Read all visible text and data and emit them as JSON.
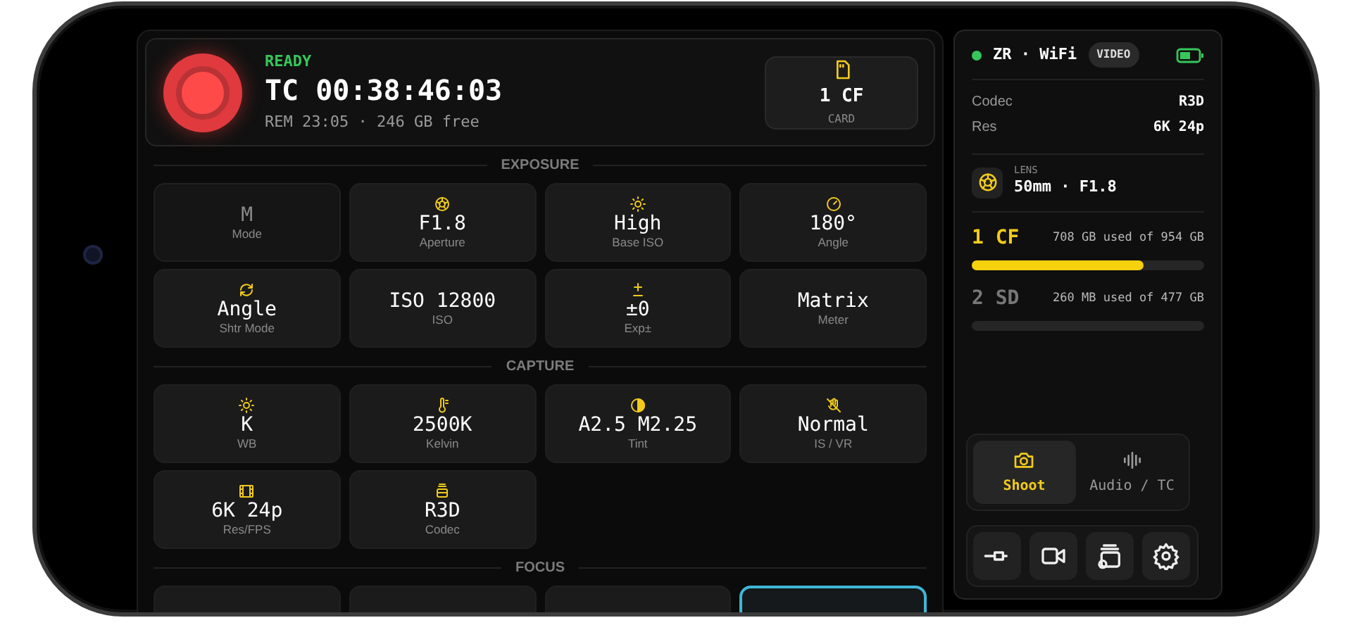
{
  "record": {
    "status": "READY",
    "timecode": "TC 00:38:46:03",
    "remaining": "REM 23:05 · 246 GB free",
    "card_value": "1 CF",
    "card_label": "CARD"
  },
  "sections": [
    {
      "title": "EXPOSURE",
      "tiles": [
        {
          "value": "M",
          "label": "Mode",
          "disabled": true
        },
        {
          "value": "F1.8",
          "label": "Aperture",
          "disabled": false
        },
        {
          "value": "High",
          "label": "Base ISO",
          "disabled": false
        },
        {
          "value": "180°",
          "label": "Angle",
          "disabled": false
        },
        {
          "value": "Angle",
          "label": "Shtr Mode",
          "disabled": false
        },
        {
          "value": "ISO 12800",
          "label": "ISO",
          "disabled": false
        },
        {
          "value": "±0",
          "label": "Exp±",
          "disabled": false
        },
        {
          "value": "Matrix",
          "label": "Meter",
          "disabled": false
        }
      ]
    },
    {
      "title": "CAPTURE",
      "tiles": [
        {
          "value": "K",
          "label": "WB",
          "disabled": false
        },
        {
          "value": "2500K",
          "label": "Kelvin",
          "disabled": false
        },
        {
          "value": "A2.5 M2.25",
          "label": "Tint",
          "disabled": false
        },
        {
          "value": "Normal",
          "label": "IS / VR",
          "disabled": false
        },
        {
          "value": "6K 24p",
          "label": "Res/FPS",
          "disabled": false
        },
        {
          "value": "R3D",
          "label": "Codec",
          "disabled": false
        }
      ]
    },
    {
      "title": "FOCUS",
      "tiles": [
        {
          "selected": false
        },
        {
          "selected": false
        },
        {
          "selected": false
        },
        {
          "selected": true
        }
      ]
    }
  ],
  "side": {
    "connected": true,
    "connection": "ZR · WiFi",
    "mode_badge": "VIDEO",
    "specs": [
      {
        "label": "Codec",
        "value": "R3D"
      },
      {
        "label": "Res",
        "value": "6K 24p"
      }
    ],
    "lens": {
      "label": "LENS",
      "value": "50mm · F1.8"
    },
    "storage": [
      {
        "name": "1 CF",
        "usage": "708 GB used of 954 GB",
        "level": 0.74,
        "active": true
      },
      {
        "name": "2 SD",
        "usage": "260 MB used of 477 GB",
        "level": 0,
        "active": false
      }
    ],
    "tabs": [
      {
        "label": "Shoot",
        "selected": true
      },
      {
        "label": "Audio / TC",
        "selected": false
      }
    ]
  }
}
